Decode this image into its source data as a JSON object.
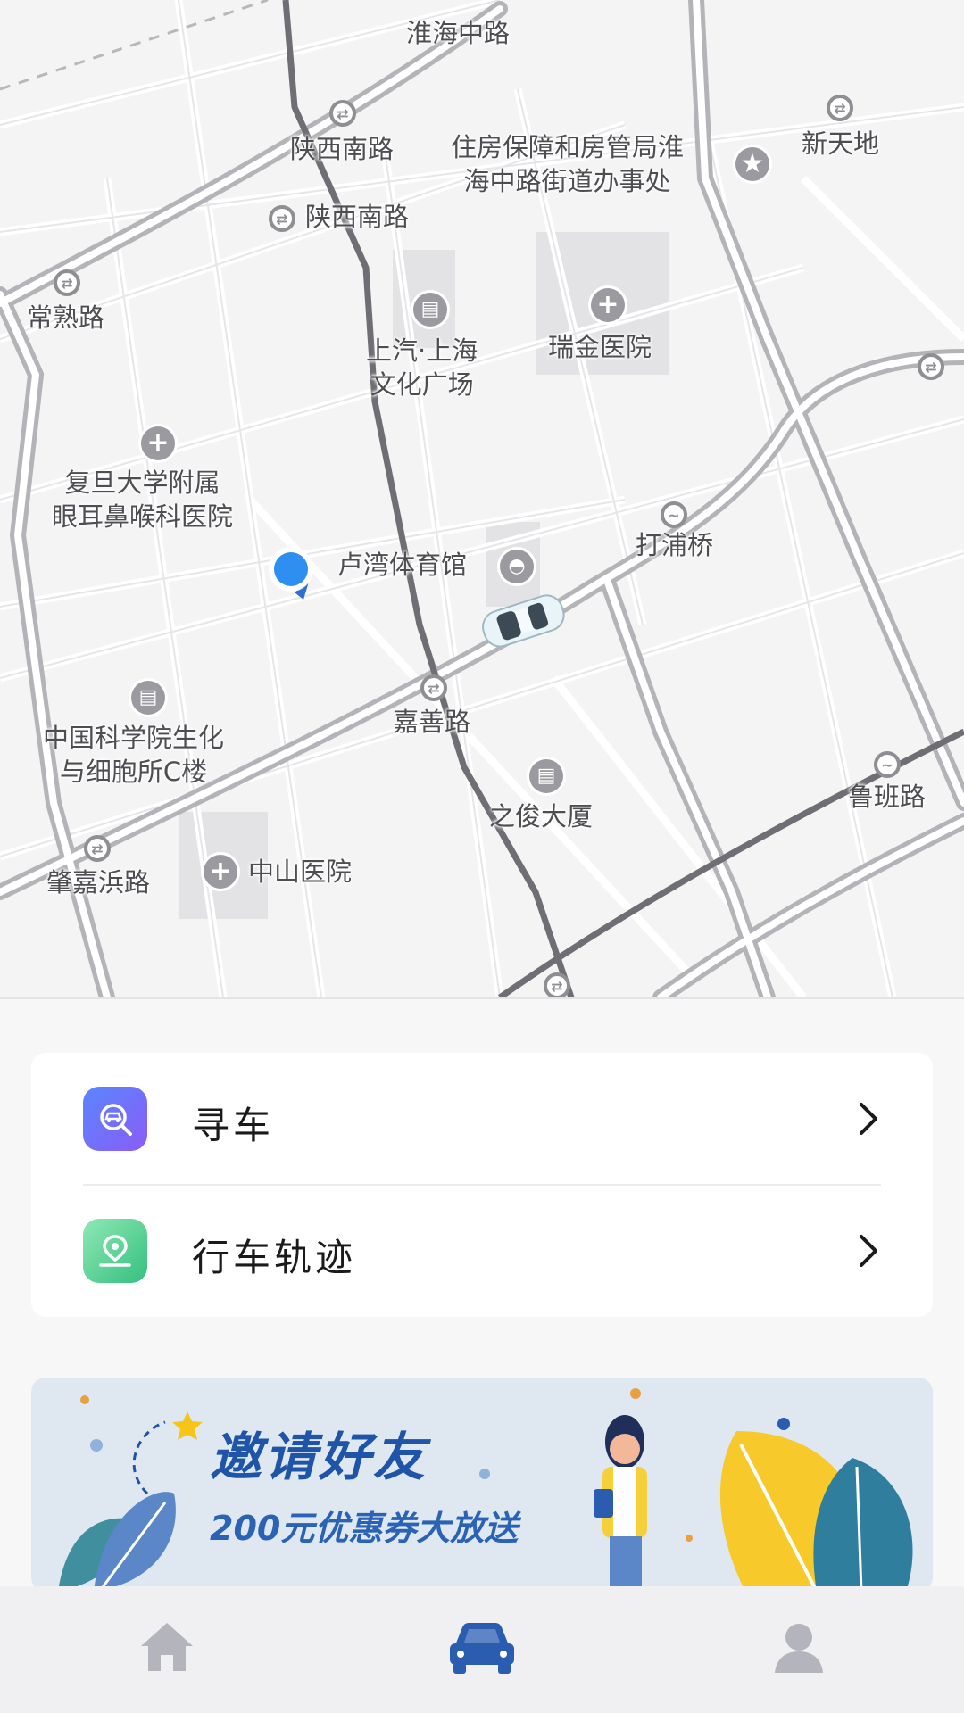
{
  "map": {
    "labels": {
      "huaihai_zhonglu": "淮海中路",
      "shaanxi_nanlu_1": "陕西南路",
      "housing_office": "住房保障和房管局淮\n海中路街道办事处",
      "xintiandi": "新天地",
      "shaanxi_nanlu_2": "陕西南路",
      "changshu_lu": "常熟路",
      "saic_plaza": "上汽·上海\n文化广场",
      "ruijin_hospital": "瑞金医院",
      "fudan_eent": "复旦大学附属\n眼耳鼻喉科医院",
      "luwan_stadium": "卢湾体育馆",
      "dapuqiao": "打浦桥",
      "jiashan_lu": "嘉善路",
      "cas_cell": "中国科学院生化\n与细胞所C楼",
      "zhijun_building": "之俊大厦",
      "luban_lu": "鲁班路",
      "zhaojiabang_lu": "肇嘉浜路",
      "zhongshan_hospital": "中山医院"
    }
  },
  "menu": {
    "items": [
      {
        "label": "寻车",
        "icon": "find-car-icon"
      },
      {
        "label": "行车轨迹",
        "icon": "driving-track-icon"
      }
    ]
  },
  "banner": {
    "title": "邀请好友",
    "subtitle": "200元优惠券大放送"
  },
  "tabbar": {
    "tabs": [
      {
        "icon": "home-icon",
        "active": false
      },
      {
        "icon": "car-icon",
        "active": true
      },
      {
        "icon": "profile-icon",
        "active": false
      }
    ]
  },
  "colors": {
    "accent": "#2a5db0",
    "user_dot": "#2e8ff0",
    "inactive_tab": "#b4b4bc",
    "find_car_gradient": [
      "#5c7cfa",
      "#8a5cf6"
    ],
    "track_gradient": [
      "#7be0a4",
      "#34c080"
    ]
  }
}
